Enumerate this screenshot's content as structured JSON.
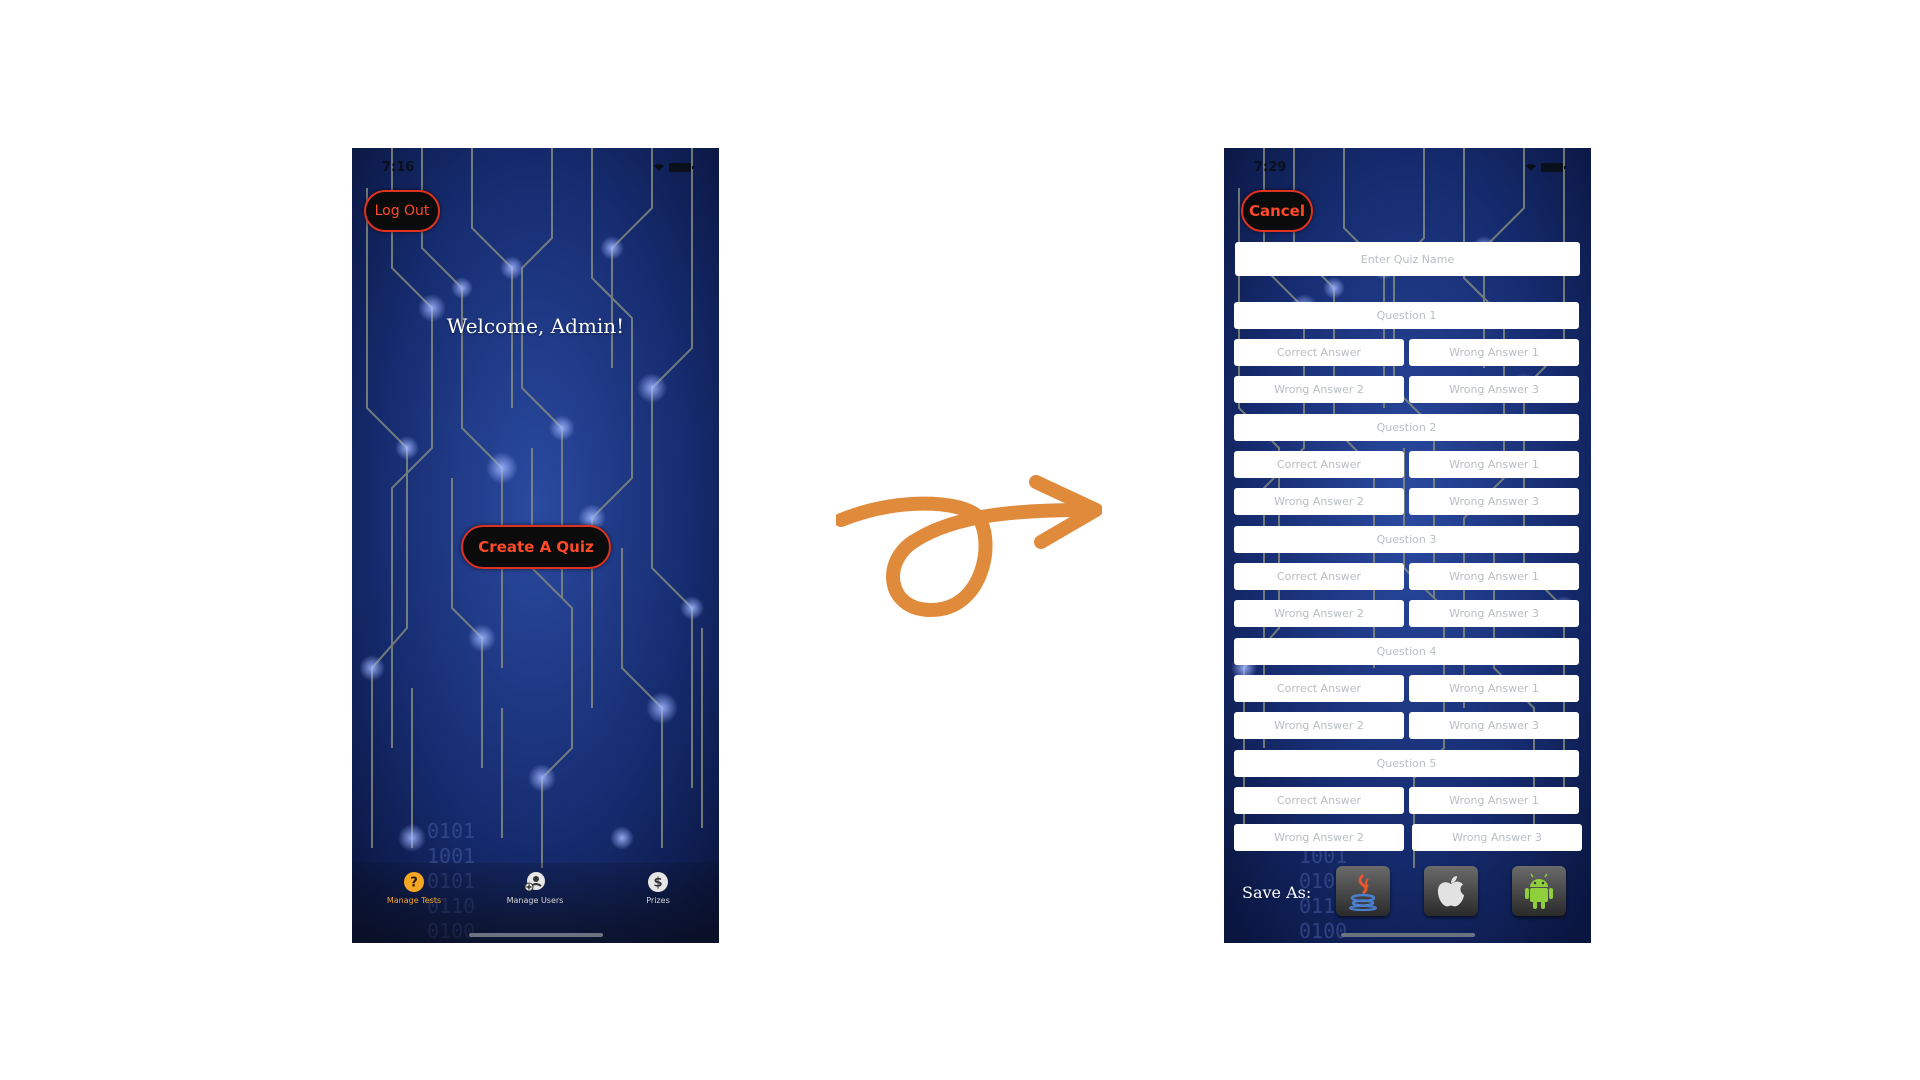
{
  "left_screen": {
    "status_time": "7:16",
    "logout_label": "Log Out",
    "welcome_text": "Welcome, Admin!",
    "create_quiz_label": "Create A Quiz",
    "tabs": [
      {
        "label": "Manage Tests",
        "icon": "question-circle-icon",
        "active": true
      },
      {
        "label": "Manage Users",
        "icon": "add-user-icon",
        "active": false
      },
      {
        "label": "Prizes",
        "icon": "dollar-circle-icon",
        "active": false
      }
    ]
  },
  "right_screen": {
    "status_time": "7:29",
    "cancel_label": "Cancel",
    "quiz_name_placeholder": "Enter Quiz  Name",
    "questions": [
      {
        "question": "Question 1",
        "correct": "Correct Answer",
        "wrong1": "Wrong Answer 1",
        "wrong2": "Wrong Answer 2",
        "wrong3": "Wrong Answer 3"
      },
      {
        "question": "Question 2",
        "correct": "Correct Answer",
        "wrong1": "Wrong Answer 1",
        "wrong2": "Wrong Answer 2",
        "wrong3": "Wrong Answer 3"
      },
      {
        "question": "Question 3",
        "correct": "Correct Answer",
        "wrong1": "Wrong Answer 1",
        "wrong2": "Wrong Answer 2",
        "wrong3": "Wrong Answer 3"
      },
      {
        "question": "Question 4",
        "correct": "Correct Answer",
        "wrong1": "Wrong Answer 1",
        "wrong2": "Wrong Answer 2",
        "wrong3": "Wrong Answer 3"
      },
      {
        "question": "Question 5",
        "correct": "Correct Answer",
        "wrong1": "Wrong Answer 1",
        "wrong2": "Wrong Answer 2",
        "wrong3": "Wrong Answer 3"
      }
    ],
    "save_as_label": "Save As:",
    "save_options": [
      "java-icon",
      "apple-icon",
      "android-icon"
    ]
  },
  "colors": {
    "background_blue": "#14286a",
    "button_border": "#e0321e",
    "button_text": "#ff4a2a",
    "active_tab": "#f5a623",
    "arrow": "#e08a3c"
  }
}
